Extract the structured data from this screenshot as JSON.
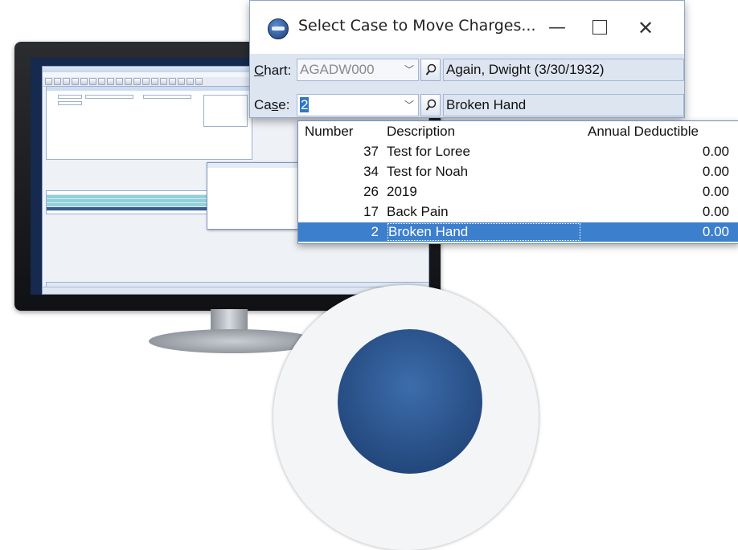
{
  "dialog": {
    "title": "Select Case to Move Charges...",
    "minimize_glyph": "—",
    "close_glyph": "✕",
    "chart": {
      "label_prefix": "",
      "label_underlined": "C",
      "label_rest": "hart:",
      "value": "AGADW000",
      "patient_display": "Again, Dwight  (3/30/1932)"
    },
    "case": {
      "label_prefix": "Ca",
      "label_underlined": "s",
      "label_rest": "e:",
      "value": "2",
      "case_display": "Broken Hand"
    }
  },
  "case_list": {
    "columns": [
      "Number",
      "Description",
      "Annual Deductible"
    ],
    "rows": [
      {
        "number": "37",
        "description": "Test for Loree",
        "deductible": "0.00"
      },
      {
        "number": "34",
        "description": "Test for Noah",
        "deductible": "0.00"
      },
      {
        "number": "26",
        "description": "2019",
        "deductible": "0.00"
      },
      {
        "number": "17",
        "description": "Back Pain",
        "deductible": "0.00"
      },
      {
        "number": "2",
        "description": "Broken Hand",
        "deductible": "0.00"
      }
    ],
    "selected_index": 4
  },
  "colors": {
    "selection": "#3c7fcc",
    "dialog_body": "#dde5f1",
    "monitor_frame": "#1c1d21"
  },
  "icons": {
    "app_icon": "medisoft-logo-icon",
    "search": "magnifier-icon",
    "combo": "chevron-down-icon"
  }
}
